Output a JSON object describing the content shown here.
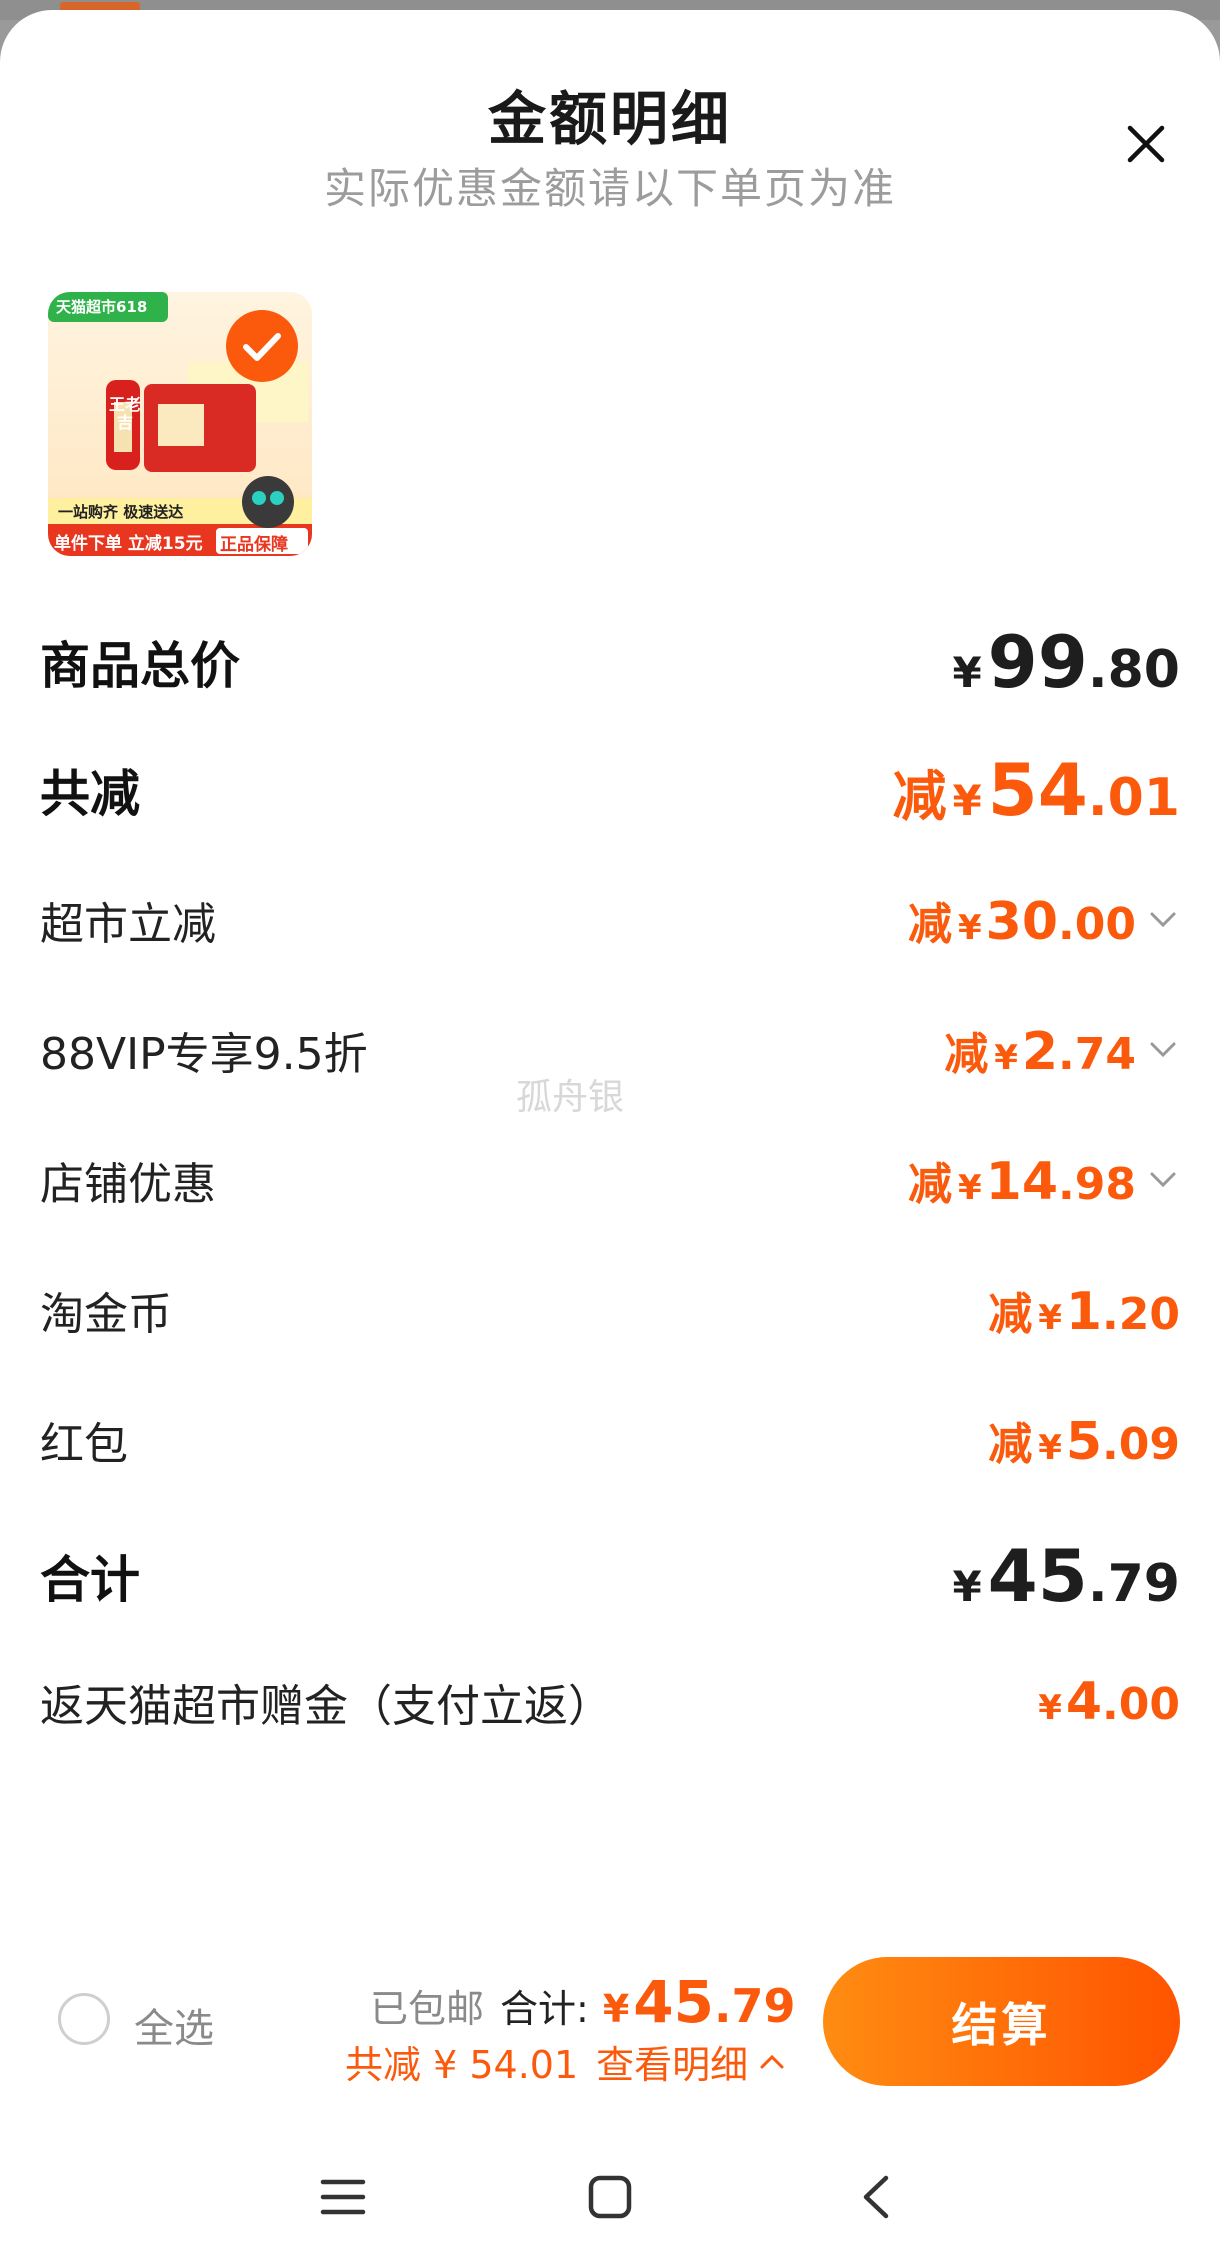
{
  "header": {
    "title": "金额明细",
    "subtitle": "实际优惠金额请以下单页为准"
  },
  "product": {
    "badge": "天猫超市618",
    "slogan": "一站购齐 极速送达",
    "promo": "单件下单 立减15元",
    "guarantee": "正品保障",
    "brand": "王老吉",
    "selected": true
  },
  "rows": {
    "total_price": {
      "label": "商品总价",
      "currency": "¥",
      "int": "99",
      "dec": ".80"
    },
    "total_discount": {
      "label": "共减",
      "prefix": "减",
      "currency": "¥",
      "int": "54",
      "dec": ".01"
    },
    "supermarket": {
      "label": "超市立减",
      "prefix": "减",
      "currency": "¥",
      "int": "30",
      "dec": ".00"
    },
    "vip": {
      "label": "88VIP专享9.5折",
      "prefix": "减",
      "currency": "¥",
      "int": "2",
      "dec": ".74"
    },
    "shop": {
      "label": "店铺优惠",
      "prefix": "减",
      "currency": "¥",
      "int": "14",
      "dec": ".98"
    },
    "coins": {
      "label": "淘金币",
      "prefix": "减",
      "currency": "¥",
      "int": "1",
      "dec": ".20"
    },
    "redpacket": {
      "label": "红包",
      "prefix": "减",
      "currency": "¥",
      "int": "5",
      "dec": ".09"
    },
    "sum": {
      "label": "合计",
      "currency": "¥",
      "int": "45",
      "dec": ".79"
    },
    "cashback": {
      "label": "返天猫超市赠金（支付立返）",
      "currency": "¥",
      "int": "4",
      "dec": ".00"
    }
  },
  "watermark": "孤舟银",
  "footer": {
    "select_all": "全选",
    "shipping": "已包邮",
    "total_label": "合计:",
    "currency": "¥",
    "total_int": "45",
    "total_dec": ".79",
    "discount_text": "共减 ¥ 54.01",
    "detail_link": "查看明细",
    "checkout": "结算"
  },
  "colors": {
    "accent": "#fb5a0d",
    "button_start": "#ff8c12",
    "button_end": "#ff5400"
  }
}
